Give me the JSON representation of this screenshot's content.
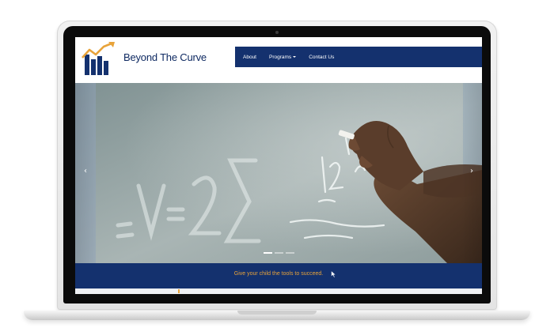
{
  "site": {
    "brand_name": "Beyond The Curve",
    "logo_icon": "rising-bar-chart-arrow-logo",
    "colors": {
      "navy": "#14316e",
      "accent_orange": "#e8a33a",
      "brand_text": "#0f2a62"
    }
  },
  "nav": {
    "items": [
      {
        "label": "About",
        "dropdown": false
      },
      {
        "label": "Programs",
        "dropdown": true
      },
      {
        "label": "Contact Us",
        "dropdown": false
      }
    ]
  },
  "hero": {
    "prev_icon": "chevron-left-icon",
    "next_icon": "chevron-right-icon",
    "prev_symbol": "‹",
    "next_symbol": "›",
    "slide_count": 3,
    "active_slide": 1
  },
  "tagline": "Give your child the tools to succeed."
}
